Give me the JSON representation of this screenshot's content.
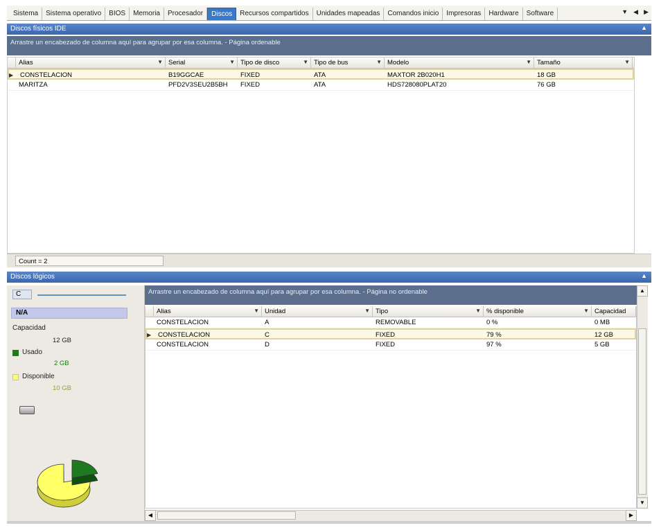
{
  "tabs": [
    "Sistema",
    "Sistema operativo",
    "BIOS",
    "Memoria",
    "Procesador",
    "Discos",
    "Recursos compartidos",
    "Unidades mapeadas",
    "Comandos inicio",
    "Impresoras",
    "Hardware",
    "Software"
  ],
  "active_tab": "Discos",
  "tab_nav": {
    "menu": "▼",
    "prev": "◀",
    "next": "▶"
  },
  "physical": {
    "title": "Discos físicos IDE",
    "group_hint": "Arrastre un encabezado de columna aquí para agrupar por esa columna. - Página ordenable",
    "columns": [
      "Alias",
      "Serial",
      "Tipo de disco",
      "Tipo de bus",
      "Modelo",
      "Tamaño"
    ],
    "rows": [
      [
        "CONSTELACION",
        "B19GGCAE",
        "FIXED",
        "ATA",
        "MAXTOR 2B020H1",
        "18 GB"
      ],
      [
        "MARITZA",
        "PFD2V3SEU2B5BH",
        "FIXED",
        "ATA",
        "HDS728080PLAT20",
        "76 GB"
      ]
    ],
    "count": "Count = 2"
  },
  "logical": {
    "title": "Discos lógicos",
    "drive": "C",
    "filesystem": "N/A",
    "capacity_label": "Capacidad",
    "capacity_value": "12 GB",
    "used_label": "Usado",
    "used_value": "2 GB",
    "free_label": "Disponible",
    "free_value": "10 GB",
    "used_fraction": 0.21,
    "group_hint": "Arrastre un encabezado de columna aquí para agrupar por esa columna. - Página no ordenable",
    "columns": [
      "Alias",
      "Unidad",
      "Tipo",
      "% disponible",
      "Capacidad"
    ],
    "rows": [
      [
        "CONSTELACION",
        "A",
        "REMOVABLE",
        "0 %",
        "0 MB"
      ],
      [
        "CONSTELACION",
        "C",
        "FIXED",
        "79 %",
        "12 GB"
      ],
      [
        "CONSTELACION",
        "D",
        "FIXED",
        "97 %",
        "5 GB"
      ]
    ]
  },
  "colors": {
    "used": "#1e7a1e",
    "free": "#ffff66",
    "accent": "#3c78c8"
  }
}
